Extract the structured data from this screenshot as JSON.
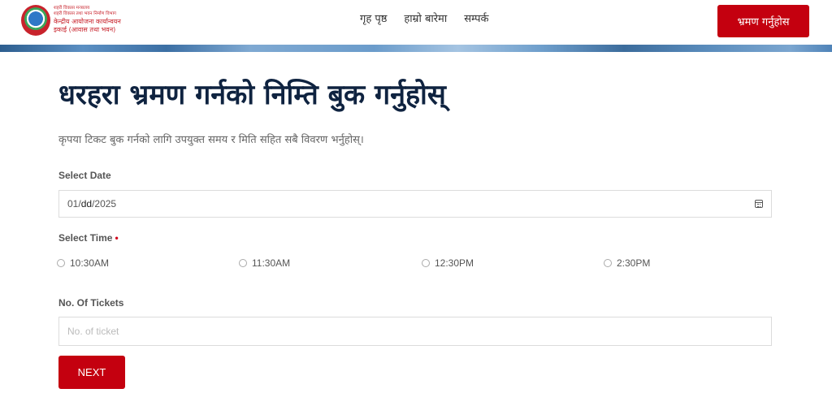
{
  "header": {
    "logo": {
      "lines": [
        "शहरी विकास मन्त्रालय",
        "शहरी विकास तथा भवन निर्माण विभाग",
        "केन्द्रीय आयोजना कार्यान्वयन",
        "इकाई (आवास तथा भवन)"
      ]
    },
    "nav": [
      {
        "label": "गृह पृष्ठ"
      },
      {
        "label": "हाम्रो बारेमा"
      },
      {
        "label": "सम्पर्क"
      }
    ],
    "cta_label": "भ्रमण गर्नुहोस"
  },
  "main": {
    "title": "धरहरा भ्रमण गर्नको निम्ति बुक गर्नुहोस्",
    "subtitle": "कृपया टिकट बुक गर्नको लागि उपयुक्त समय र मिति सहित सबै विवरण भर्नुहोस्।",
    "date": {
      "label": "Select Date",
      "value_month": "01",
      "value_day": "dd",
      "value_year": "2025",
      "icon": "calendar-icon"
    },
    "time": {
      "label": "Select Time",
      "required_marker": "•",
      "options": [
        {
          "label": "10:30AM",
          "selected": false
        },
        {
          "label": "11:30AM",
          "selected": false
        },
        {
          "label": "12:30PM",
          "selected": false
        },
        {
          "label": "2:30PM",
          "selected": false
        }
      ]
    },
    "tickets": {
      "label": "No. Of Tickets",
      "placeholder": "No. of ticket",
      "value": ""
    },
    "next_label": "NEXT"
  },
  "colors": {
    "accent": "#c4000f",
    "title": "#0f2340",
    "logo_text": "#c8232c"
  }
}
